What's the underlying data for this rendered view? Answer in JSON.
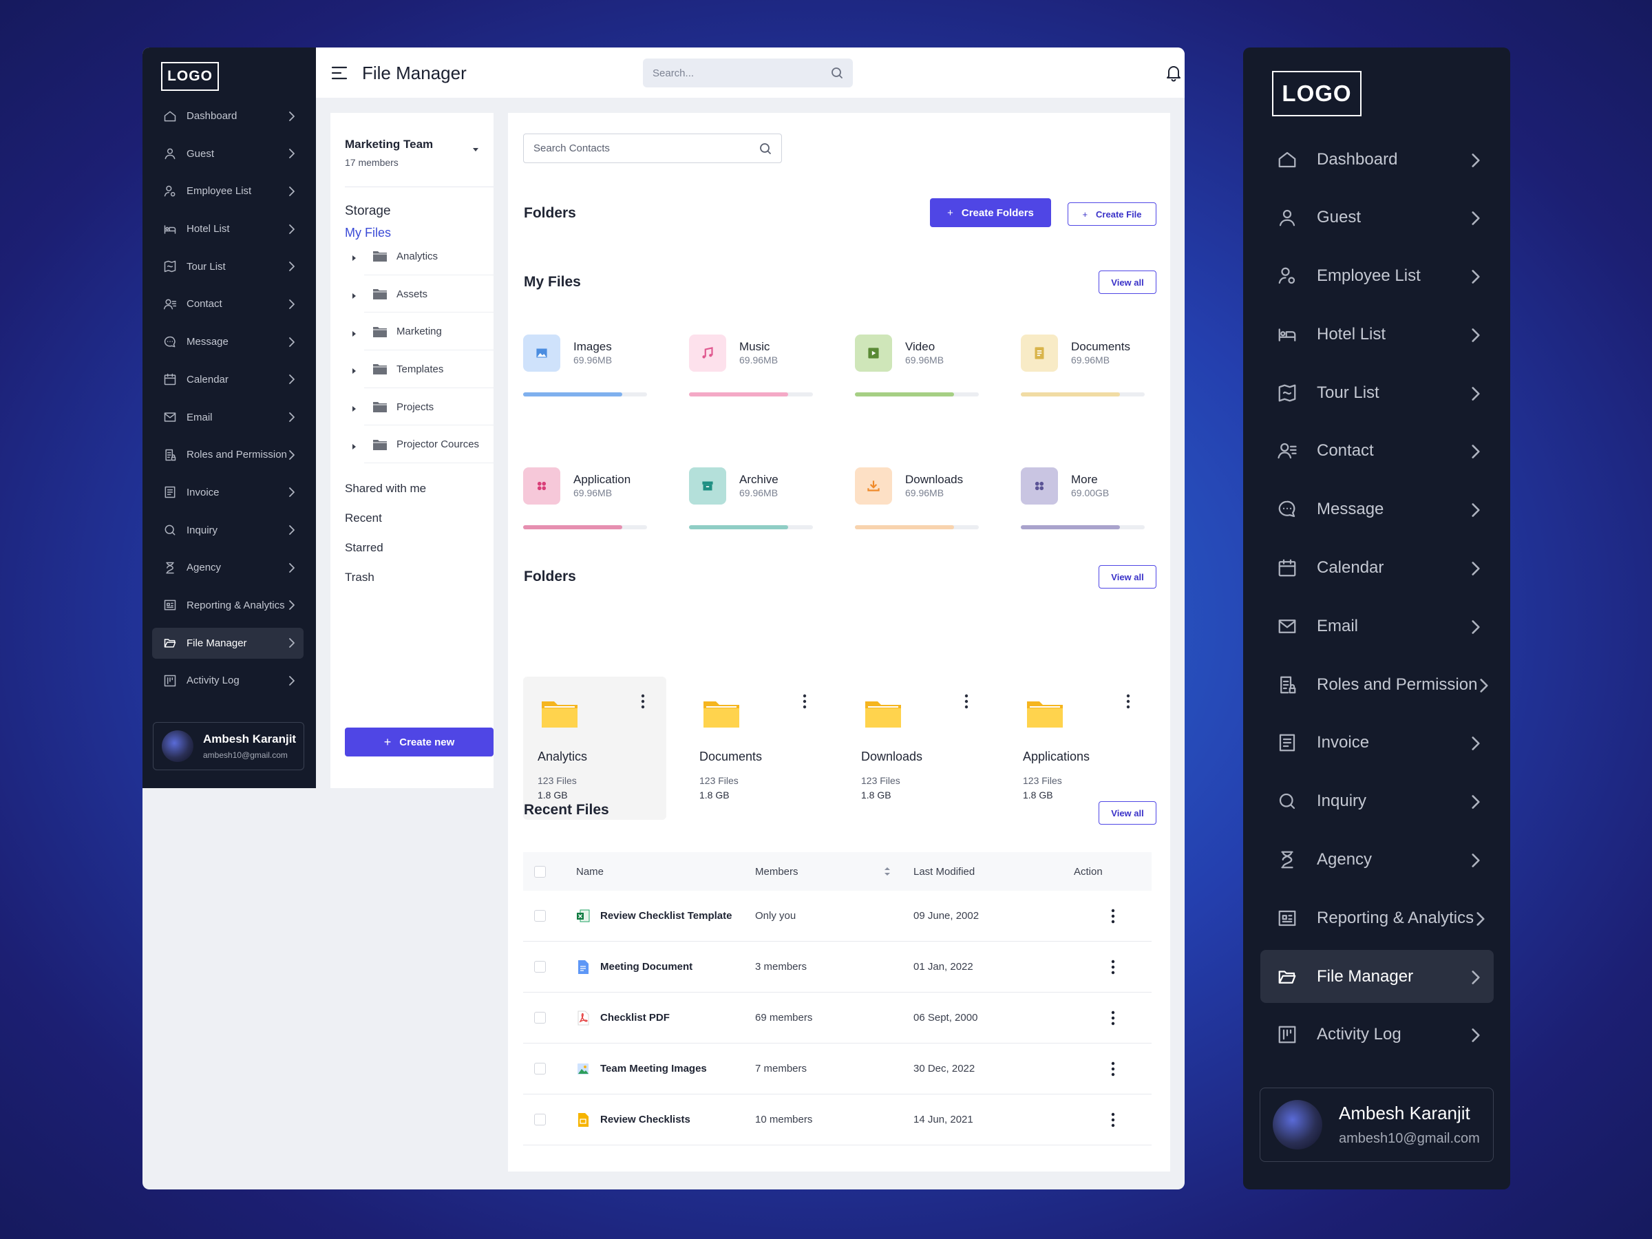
{
  "logo": "LOGO",
  "nav": [
    {
      "label": "Dashboard",
      "icon": "home-icon"
    },
    {
      "label": "Guest",
      "icon": "user-icon"
    },
    {
      "label": "Employee List",
      "icon": "user-gear-icon"
    },
    {
      "label": "Hotel List",
      "icon": "bed-icon"
    },
    {
      "label": "Tour List",
      "icon": "map-icon"
    },
    {
      "label": "Contact",
      "icon": "contact-icon"
    },
    {
      "label": "Message",
      "icon": "chat-bubble-icon"
    },
    {
      "label": "Calendar",
      "icon": "calendar-icon"
    },
    {
      "label": "Email",
      "icon": "mail-icon"
    },
    {
      "label": "Roles and Permission",
      "icon": "document-lock-icon"
    },
    {
      "label": "Invoice",
      "icon": "invoice-icon"
    },
    {
      "label": "Inquiry",
      "icon": "search-icon"
    },
    {
      "label": "Agency",
      "icon": "hourglass-icon"
    },
    {
      "label": "Reporting & Analytics",
      "icon": "report-icon"
    },
    {
      "label": "File Manager",
      "icon": "folder-open-icon",
      "active": true
    },
    {
      "label": "Activity Log",
      "icon": "activity-icon"
    }
  ],
  "user": {
    "name": "Ambesh Karanjit",
    "email": "ambesh10@gmail.com"
  },
  "header": {
    "title": "File Manager",
    "search_placeholder": "Search..."
  },
  "tree": {
    "team_name": "Marketing Team",
    "team_members": "17 members",
    "storage": "Storage",
    "my_files": "My Files",
    "folders": [
      "Analytics",
      "Assets",
      "Marketing",
      "Templates",
      "Projects",
      "Projector Cources"
    ],
    "links": [
      "Shared with me",
      "Recent",
      "Starred",
      "Trash"
    ],
    "create_new": "Create new"
  },
  "content": {
    "search_placeholder": "Search Contacts",
    "folders_title": "Folders",
    "create_folders": "Create Folders",
    "create_file": "Create File",
    "my_files_title": "My Files",
    "view_all": "View all",
    "file_types": [
      {
        "name": "Images",
        "size": "69.96MB",
        "usage": 0.8,
        "color": "#7fb0ee",
        "bg": "#cfe2fb"
      },
      {
        "name": "Music",
        "size": "69.96MB",
        "usage": 0.8,
        "color": "#f4a9c6",
        "bg": "#fde1ec"
      },
      {
        "name": "Video",
        "size": "69.96MB",
        "usage": 0.8,
        "color": "#a6cf84",
        "bg": "#cfe6b9"
      },
      {
        "name": "Documents",
        "size": "69.96MB",
        "usage": 0.8,
        "color": "#f1dca4",
        "bg": "#f8ebc6"
      },
      {
        "name": "Application",
        "size": "69.96MB",
        "usage": 0.8,
        "color": "#e68fb0",
        "bg": "#f6c8d9"
      },
      {
        "name": "Archive",
        "size": "69.96MB",
        "usage": 0.8,
        "color": "#8fcdc5",
        "bg": "#b4e0da"
      },
      {
        "name": "Downloads",
        "size": "69.96MB",
        "usage": 0.8,
        "color": "#f8d3ae",
        "bg": "#fde0c5"
      },
      {
        "name": "More",
        "size": "69.00GB",
        "usage": 0.8,
        "color": "#a9a3cc",
        "bg": "#c9c5e2"
      }
    ],
    "folder_cards": [
      {
        "name": "Analytics",
        "files": "123 Files",
        "size": "1.8 GB"
      },
      {
        "name": "Documents",
        "files": "123 Files",
        "size": "1.8 GB"
      },
      {
        "name": "Downloads",
        "files": "123 Files",
        "size": "1.8 GB"
      },
      {
        "name": "Applications",
        "files": "123 Files",
        "size": "1.8 GB"
      }
    ],
    "recent_title": "Recent Files",
    "table_headers": {
      "name": "Name",
      "members": "Members",
      "modified": "Last Modified",
      "action": "Action"
    },
    "recent_files": [
      {
        "name": "Review Checklist Template",
        "members": "Only you",
        "modified": "09 June, 2002",
        "type": "excel-icon"
      },
      {
        "name": "Meeting Document",
        "members": "3 members",
        "modified": "01 Jan, 2022",
        "type": "doc-icon"
      },
      {
        "name": "Checklist PDF",
        "members": "69 members",
        "modified": "06 Sept, 2000",
        "type": "pdf-icon"
      },
      {
        "name": "Team Meeting Images",
        "members": "7 members",
        "modified": "30 Dec, 2022",
        "type": "image-file-icon"
      },
      {
        "name": "Review Checklists",
        "members": "10 members",
        "modified": "14 Jun, 2021",
        "type": "slides-icon"
      }
    ]
  }
}
